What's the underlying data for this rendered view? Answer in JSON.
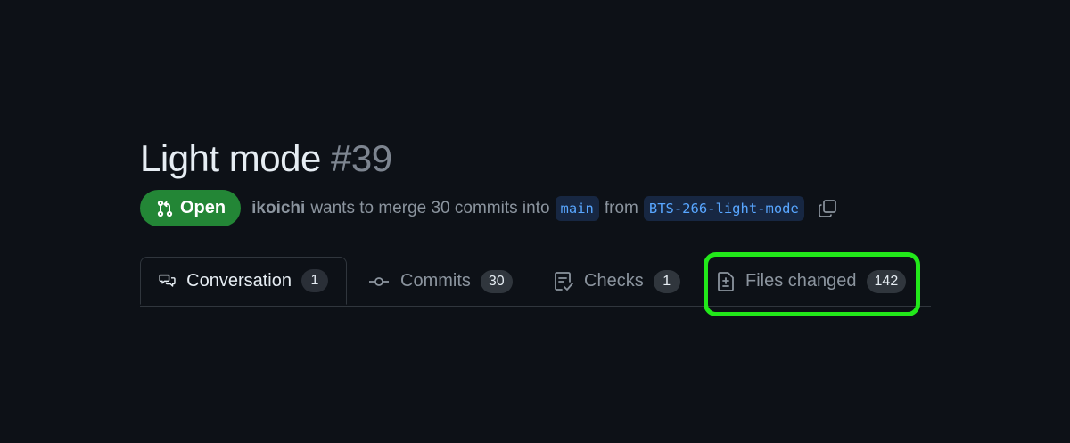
{
  "pr": {
    "title": "Light mode",
    "number": "#39",
    "state": "Open",
    "author": "ikoichi",
    "merge_text": "wants to merge 30 commits into",
    "base_branch": "main",
    "from_text": "from",
    "head_branch": "BTS-266-light-mode"
  },
  "tabs": [
    {
      "label": "Conversation",
      "count": "1",
      "icon": "comment-discussion-icon",
      "active": true
    },
    {
      "label": "Commits",
      "count": "30",
      "icon": "git-commit-icon",
      "active": false
    },
    {
      "label": "Checks",
      "count": "1",
      "icon": "checklist-icon",
      "active": false
    },
    {
      "label": "Files changed",
      "count": "142",
      "icon": "file-diff-icon",
      "active": false
    }
  ],
  "colors": {
    "background": "#0d1117",
    "open_badge": "#238636",
    "branch_text": "#58a6ff",
    "highlight": "#22e81a"
  }
}
